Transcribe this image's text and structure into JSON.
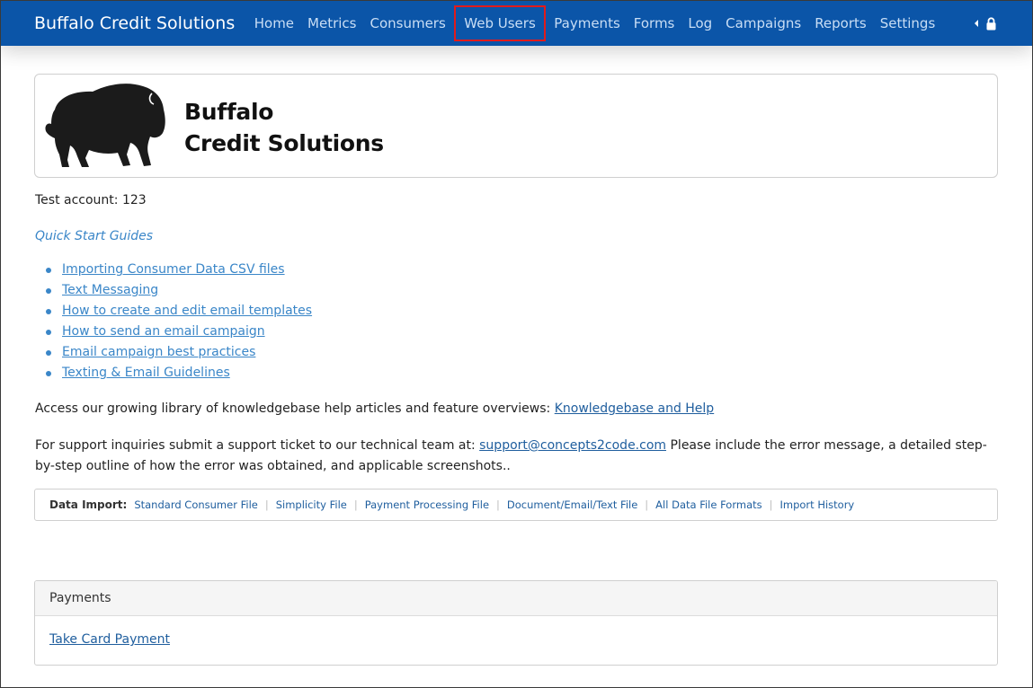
{
  "navbar": {
    "brand": "Buffalo Credit Solutions",
    "items": [
      {
        "label": "Home"
      },
      {
        "label": "Metrics"
      },
      {
        "label": "Consumers"
      },
      {
        "label": "Web Users",
        "highlighted": true
      },
      {
        "label": "Payments"
      },
      {
        "label": "Forms"
      },
      {
        "label": "Log"
      },
      {
        "label": "Campaigns"
      },
      {
        "label": "Reports"
      },
      {
        "label": "Settings"
      }
    ],
    "right_icons": [
      "caret-left-icon",
      "lock-icon"
    ],
    "colors": {
      "background": "#0b55a8",
      "text": "#c9def5",
      "highlight_border": "#e21b1b"
    }
  },
  "banner": {
    "logo_icon": "bison-icon",
    "logo_line1": "Buffalo",
    "logo_line2": "Credit Solutions"
  },
  "account": {
    "text": "Test account: 123"
  },
  "quick_start": {
    "title": "Quick Start Guides",
    "items": [
      {
        "label": "Importing Consumer Data CSV files"
      },
      {
        "label": "Text Messaging"
      },
      {
        "label": "How to create and edit email templates"
      },
      {
        "label": "How to send an email campaign"
      },
      {
        "label": "Email campaign best practices"
      },
      {
        "label": "Texting & Email Guidelines"
      }
    ]
  },
  "knowledgebase": {
    "text": "Access our growing library of knowledgebase help articles and feature overviews: ",
    "link": "Knowledgebase and Help "
  },
  "support": {
    "text_before": "For support inquiries submit a support ticket to our technical team at:  ",
    "email": "support@concepts2code.com",
    "text_after": "  Please include the error message, a detailed step-by-step outline of how the error was obtained, and applicable screenshots.."
  },
  "data_import": {
    "label": "Data Import:",
    "links": [
      {
        "label": "Standard Consumer File"
      },
      {
        "label": "Simplicity File"
      },
      {
        "label": "Payment Processing File"
      },
      {
        "label": "Document/Email/Text File"
      },
      {
        "label": "All Data File Formats"
      },
      {
        "label": "Import History"
      }
    ]
  },
  "payments_panel": {
    "heading": "Payments",
    "link": "Take Card Payment"
  },
  "colors": {
    "link": "#3a86c8",
    "link_dark": "#1f5e9e"
  }
}
